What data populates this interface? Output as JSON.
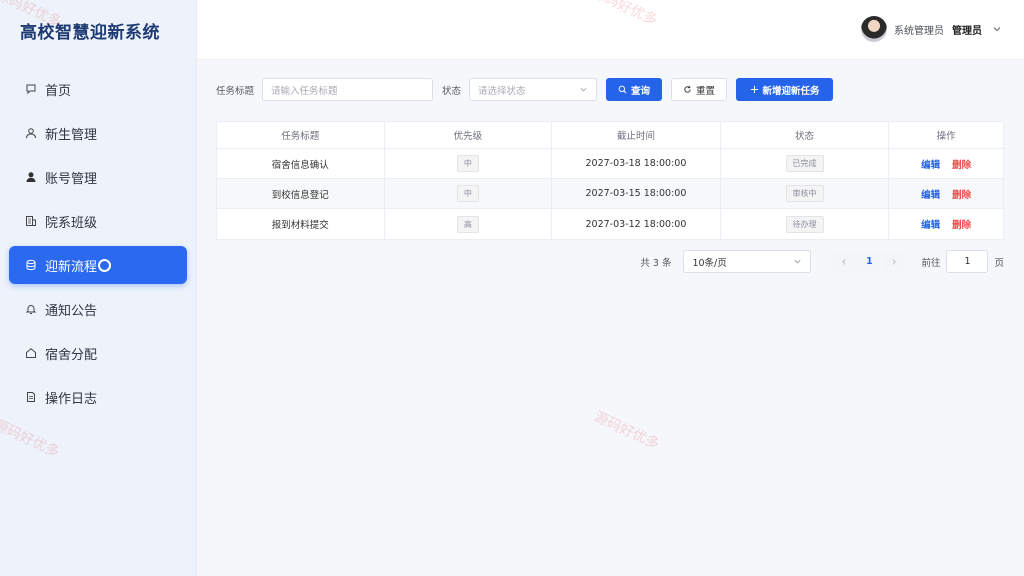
{
  "app": {
    "title": "高校智慧迎新系统"
  },
  "sidebar": {
    "items": [
      {
        "label": "首页",
        "icon": "home-icon"
      },
      {
        "label": "新生管理",
        "icon": "user-icon"
      },
      {
        "label": "账号管理",
        "icon": "account-icon"
      },
      {
        "label": "院系班级",
        "icon": "building-icon"
      },
      {
        "label": "迎新流程",
        "icon": "flow-icon",
        "active": true
      },
      {
        "label": "通知公告",
        "icon": "bell-icon"
      },
      {
        "label": "宿舍分配",
        "icon": "house-icon"
      },
      {
        "label": "操作日志",
        "icon": "document-icon"
      }
    ]
  },
  "header": {
    "role": "系统管理员",
    "name": "管理员"
  },
  "filter": {
    "title_label": "任务标题",
    "title_placeholder": "请输入任务标题",
    "status_label": "状态",
    "status_placeholder": "请选择状态",
    "search_label": "查询",
    "reset_label": "重置",
    "add_label": "新增迎新任务"
  },
  "table": {
    "headers": [
      "任务标题",
      "优先级",
      "截止时间",
      "状态",
      "操作"
    ],
    "rows": [
      {
        "title": "宿舍信息确认",
        "priority": "中",
        "deadline": "2027-03-18 18:00:00",
        "status": "已完成"
      },
      {
        "title": "到校信息登记",
        "priority": "中",
        "deadline": "2027-03-15 18:00:00",
        "status": "审核中"
      },
      {
        "title": "报到材料提交",
        "priority": "高",
        "deadline": "2027-03-12 18:00:00",
        "status": "待办理"
      }
    ],
    "edit_label": "编辑",
    "delete_label": "删除"
  },
  "pagination": {
    "total_text": "共 3 条",
    "page_size": "10条/页",
    "current_page": "1",
    "goto_label": "前往",
    "goto_value": "1",
    "page_suffix": "页"
  },
  "watermark": "源码好优多",
  "colors": {
    "accent": "#2563eb",
    "danger": "#f04b4b",
    "brand": "#1e3a72"
  }
}
